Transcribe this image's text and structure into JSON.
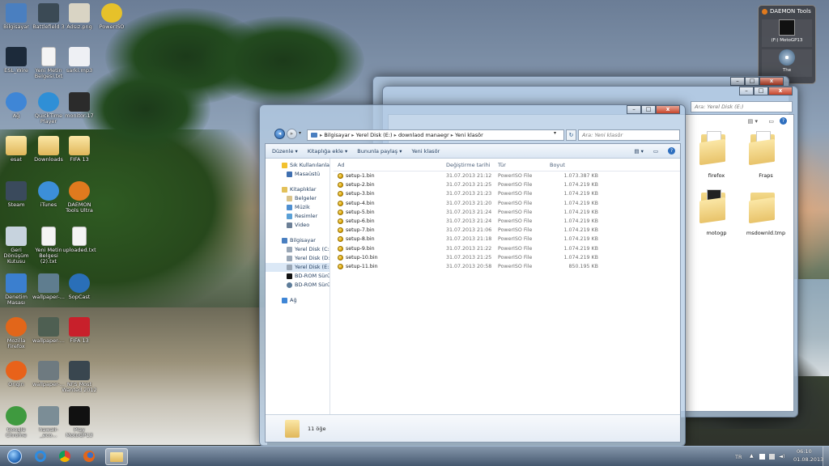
{
  "desktop": {
    "icons": [
      {
        "label": "Bilgisayar",
        "icon": "computer-icon",
        "color": "#4a7fc0"
      },
      {
        "label": "Battlefield 3",
        "icon": "battlefield-icon",
        "color": "#3b4a55"
      },
      {
        "label": "Adsız.png",
        "icon": "image-file-icon",
        "color": "#d9d4c4"
      },
      {
        "label": "PowerISO",
        "icon": "poweriso-icon",
        "color": "#e6c12a"
      },
      {
        "label": "ESL_Wire",
        "icon": "esl-wire-icon",
        "color": "#1c2a3a"
      },
      {
        "label": "Yeni Metin Belgesi.txt",
        "icon": "text-file-icon",
        "color": "#f4f4f4"
      },
      {
        "label": "sarki.mp3",
        "icon": "mp3-file-icon",
        "color": "#eef0f4"
      },
      {
        "label": "Ağ",
        "icon": "network-icon",
        "color": "#3f86d6"
      },
      {
        "label": "QuickTime Player",
        "icon": "quicktime-icon",
        "color": "#2f8fd6"
      },
      {
        "label": "monitor-17",
        "icon": "monitor-icon",
        "color": "#2b2b2b"
      },
      {
        "label": "esat",
        "icon": "folder-icon",
        "color": "#e8c36a"
      },
      {
        "label": "Downloads",
        "icon": "folder-icon",
        "color": "#e8c36a"
      },
      {
        "label": "FIFA 13",
        "icon": "folder-icon",
        "color": "#e8c36a"
      },
      {
        "label": "Steam",
        "icon": "steam-icon",
        "color": "#3a4a5c"
      },
      {
        "label": "iTunes",
        "icon": "itunes-icon",
        "color": "#3c8fd8"
      },
      {
        "label": "DAEMON Tools Ultra",
        "icon": "daemon-tools-icon",
        "color": "#e07a1e"
      },
      {
        "label": "Geri Dönüşüm Kutusu",
        "icon": "recycle-bin-icon",
        "color": "#c7d3de"
      },
      {
        "label": "Yeni Metin Belgesi (2).txt",
        "icon": "text-file-icon",
        "color": "#f4f4f4"
      },
      {
        "label": "uploaded.txt",
        "icon": "text-file-icon",
        "color": "#f4f4f4"
      },
      {
        "label": "Denetim Masası",
        "icon": "control-panel-icon",
        "color": "#3b7fcf"
      },
      {
        "label": "wallpaper-...",
        "icon": "wallpaper-file-icon",
        "color": "#5f7d8f"
      },
      {
        "label": "SopCast",
        "icon": "sopcast-icon",
        "color": "#2a6fb8"
      },
      {
        "label": "Mozilla Firefox",
        "icon": "firefox-icon",
        "color": "#e2661a"
      },
      {
        "label": "wallpaper-...",
        "icon": "wallpaper-file-icon",
        "color": "#4e5f52"
      },
      {
        "label": "FIFA 13",
        "icon": "fifa-icon",
        "color": "#c8202b"
      },
      {
        "label": "Origin",
        "icon": "origin-icon",
        "color": "#e8621a"
      },
      {
        "label": "wallpaper-...",
        "icon": "wallpaper-file-icon",
        "color": "#6e7a80"
      },
      {
        "label": "NFS Most Wanted 2012",
        "icon": "nfs-icon",
        "color": "#39464f"
      },
      {
        "label": "Google Chrome",
        "icon": "chrome-icon",
        "color": "#3f9a3f"
      },
      {
        "label": "hawaii-_eco...",
        "icon": "wallpaper-file-icon",
        "color": "#7b8d96"
      },
      {
        "label": "Play MotoGP13",
        "icon": "motogp-icon",
        "color": "#111111"
      }
    ]
  },
  "gadget": {
    "title": "DAEMON Tools",
    "drive1_label": "(F:) MotoGP13",
    "drive2_label": "The"
  },
  "back_window": {
    "search_placeholder": "Ara: Yerel Disk (E:)",
    "folders": [
      {
        "label": "firefox"
      },
      {
        "label": "Fraps"
      },
      {
        "label": "motogp"
      },
      {
        "label": "msdownld.tmp"
      }
    ]
  },
  "window": {
    "breadcrumb": [
      "Bilgisayar",
      "Yerel Disk (E:)",
      "downlaod manaegr",
      "Yeni klasör"
    ],
    "search_placeholder": "Ara: Yeni klasör",
    "toolbar": {
      "organize": "Düzenle",
      "include_library": "Kitaplığa ekle",
      "share": "Bununla paylaş",
      "new_folder": "Yeni klasör"
    },
    "nav": {
      "favorites": "Sık Kullanılanlar",
      "desktop": "Masaüstü",
      "libraries": "Kitaplıklar",
      "documents": "Belgeler",
      "music": "Müzik",
      "pictures": "Resimler",
      "video": "Video",
      "computer": "Bilgisayar",
      "disk_c": "Yerel Disk (C:)",
      "disk_d": "Yerel Disk (D:)",
      "disk_e": "Yerel Disk (E:)",
      "bd1": "BD-ROM Sürü",
      "bd2": "BD-ROM Sürü",
      "network": "Ağ"
    },
    "columns": {
      "name": "Ad",
      "date": "Değiştirme tarihi",
      "type": "Tür",
      "size": "Boyut"
    },
    "files": [
      {
        "name": "setup-1.bin",
        "date": "31.07.2013 21:12",
        "type": "PowerISO File",
        "size": "1.073.387 KB"
      },
      {
        "name": "setup-2.bin",
        "date": "31.07.2013 21:25",
        "type": "PowerISO File",
        "size": "1.074.219 KB"
      },
      {
        "name": "setup-3.bin",
        "date": "31.07.2013 21:23",
        "type": "PowerISO File",
        "size": "1.074.219 KB"
      },
      {
        "name": "setup-4.bin",
        "date": "31.07.2013 21:20",
        "type": "PowerISO File",
        "size": "1.074.219 KB"
      },
      {
        "name": "setup-5.bin",
        "date": "31.07.2013 21:24",
        "type": "PowerISO File",
        "size": "1.074.219 KB"
      },
      {
        "name": "setup-6.bin",
        "date": "31.07.2013 21:24",
        "type": "PowerISO File",
        "size": "1.074.219 KB"
      },
      {
        "name": "setup-7.bin",
        "date": "31.07.2013 21:06",
        "type": "PowerISO File",
        "size": "1.074.219 KB"
      },
      {
        "name": "setup-8.bin",
        "date": "31.07.2013 21:18",
        "type": "PowerISO File",
        "size": "1.074.219 KB"
      },
      {
        "name": "setup-9.bin",
        "date": "31.07.2013 21:22",
        "type": "PowerISO File",
        "size": "1.074.219 KB"
      },
      {
        "name": "setup-10.bin",
        "date": "31.07.2013 21:25",
        "type": "PowerISO File",
        "size": "1.074.219 KB"
      },
      {
        "name": "setup-11.bin",
        "date": "31.07.2013 20:58",
        "type": "PowerISO File",
        "size": "850.195 KB"
      }
    ],
    "status": "11 öğe"
  },
  "taskbar": {
    "language": "TR",
    "time": "06:10",
    "date": "01.08.2013",
    "pinned": [
      {
        "icon": "start-orb-icon",
        "color": "#3b8fd9"
      },
      {
        "icon": "internet-explorer-icon",
        "color": "#2e8be0"
      },
      {
        "icon": "chrome-icon",
        "color": "#3f9a3f"
      },
      {
        "icon": "firefox-icon",
        "color": "#e2661a"
      },
      {
        "icon": "explorer-folder-icon",
        "color": "#e8c36a"
      }
    ]
  },
  "colors": {
    "accent": "#1e395b",
    "link_text": "#1e395b",
    "close_button": "#c7452b"
  }
}
